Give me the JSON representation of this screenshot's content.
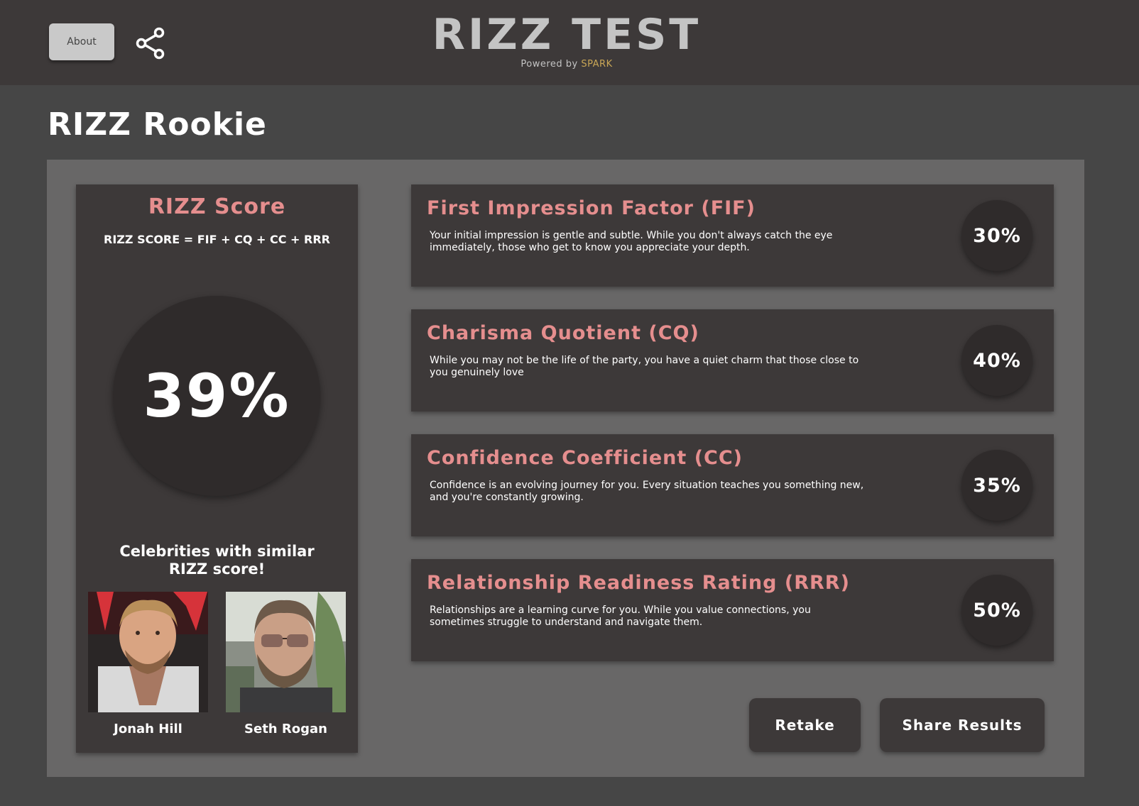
{
  "header": {
    "about_label": "About",
    "title": "RIZZ TEST",
    "powered_prefix": "Powered by",
    "powered_brand": "SPARK",
    "brand_color": "#c9a656"
  },
  "rank": "RIZZ Rookie",
  "score_card": {
    "heading": "RIZZ Score",
    "formula": "RIZZ SCORE = FIF + CQ + CC + RRR",
    "score": "39%",
    "celebrities_heading": "Celebrities with similar RIZZ score!",
    "celebrities": [
      {
        "name": "Jonah Hill"
      },
      {
        "name": "Seth Rogan"
      }
    ]
  },
  "metrics": [
    {
      "title": "First Impression Factor (FIF)",
      "description": "Your initial impression is gentle and subtle. While you don't always catch the eye immediately, those who get to know you appreciate your depth.",
      "value": "30%"
    },
    {
      "title": "Charisma Quotient (CQ)",
      "description": "While you may not be the life of the party, you have a quiet charm that those close to you genuinely love",
      "value": "40%"
    },
    {
      "title": "Confidence Coefficient (CC)",
      "description": "Confidence is an evolving journey for you. Every situation teaches you something new, and you're constantly growing.",
      "value": "35%"
    },
    {
      "title": "Relationship Readiness Rating (RRR)",
      "description": "Relationships are a learning curve for you. While you value connections, you sometimes struggle to understand and navigate them.",
      "value": "50%"
    }
  ],
  "actions": {
    "retake_label": "Retake",
    "share_label": "Share Results"
  },
  "colors": {
    "accent": "#e58e8e",
    "card": "#3d3939",
    "panel": "#686767",
    "background": "#464646"
  }
}
